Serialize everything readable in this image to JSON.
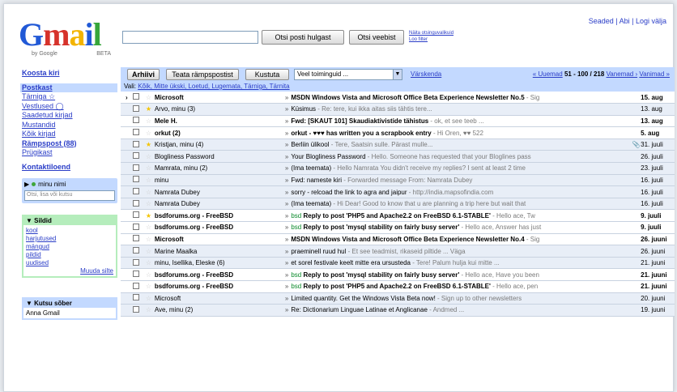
{
  "brand": {
    "logo_g": "G",
    "logo_m": "m",
    "logo_a": "a",
    "logo_i": "i",
    "logo_l": "l",
    "by": "by Google",
    "beta": "BETA"
  },
  "header": {
    "search_button": "Otsi posti hulgast",
    "web_button": "Otsi veebist",
    "search_options": "Näita otsinguvalikuid",
    "create_filter": "Loo filter",
    "top_links": "Seaded | Abi | Logi välja"
  },
  "sidebar": {
    "compose": "Koosta kiri",
    "items": [
      "Postkast",
      "Tärniga ☆",
      "Vestlused ◯",
      "Saadetud kirjad",
      "Mustandid",
      "Kõik kirjad",
      "Rämpspost (88)",
      "Prügikast"
    ],
    "contacts": "Kontaktiloend",
    "chat_status": "minu nimi",
    "chat_search_placeholder": "Otsi, lisa või kutsu",
    "labels_title": "Sildid",
    "labels": [
      "kool",
      "harjutused",
      "mängud",
      "pildid",
      "uudised"
    ],
    "labels_edit": "Muuda silte",
    "invite_title": "Kutsu sõber",
    "invite_text": "Anna Gmail"
  },
  "toolbar": {
    "archive": "Arhiivi",
    "spam": "Teata rämpspostist",
    "delete": "Kustuta",
    "more_actions": "Veel toiminguid ...",
    "refresh": "Värskenda",
    "pager_prev": "« Uuemad",
    "pager_count": "51 - 100 / 218",
    "pager_older": "Vanemad ›",
    "pager_oldest": "Vanimad »",
    "select_prefix": "Vali:",
    "select_links": "Kõik, Mitte ükski, Loetud, Lugemata, Tärniga, Tärnita"
  },
  "emails": [
    {
      "from": "Microsoft",
      "subject": "MSDN Windows Vista and Microsoft Office Beta Experience Newsletter No.5",
      "snippet": " - Sig",
      "date": "15. aug",
      "unread": true,
      "star": false,
      "arrow": true,
      "label": ""
    },
    {
      "from": "Arvo, minu (3)",
      "subject": "Küsimus",
      "snippet": " - Re: tere, kui ikka aitas siis tähtis tere...",
      "date": "13. aug",
      "unread": false,
      "star": true,
      "arrow": false,
      "label": ""
    },
    {
      "from": "Mele H.",
      "subject": "Fwd: [SKAUT 101] Skaudiaktivistide tähistus",
      "snippet": " - ok, et see teeb ...",
      "date": "13. aug",
      "unread": true,
      "star": false,
      "arrow": false,
      "label": ""
    },
    {
      "from": "orkut (2)",
      "subject": "orkut - ♥♥♥ has written you a scrapbook entry",
      "snippet": " - Hi Oren, ♥♥ 522",
      "date": "5. aug",
      "unread": true,
      "star": false,
      "arrow": false,
      "label": ""
    },
    {
      "from": "Kristjan, minu (4)",
      "subject": "Berliin ülikool",
      "snippet": " - Tere, Saatsin sulle. Pärast mulle...",
      "date": "31. juuli",
      "unread": false,
      "star": true,
      "arrow": false,
      "label": "",
      "clip": true
    },
    {
      "from": "Blogliness Password",
      "subject": "Your Blogliness Password",
      "snippet": " - Hello. Someone has requested that your Bloglines pass",
      "date": "26. juuli",
      "unread": false,
      "star": false,
      "arrow": false,
      "label": ""
    },
    {
      "from": "Mamrata, minu (2)",
      "subject": "(Ima teemata)",
      "snippet": " - Hello Namrata You didn't receive my replies? I sent at least 2 time",
      "date": "23. juuli",
      "unread": false,
      "star": false,
      "arrow": false,
      "label": ""
    },
    {
      "from": "minu",
      "subject": "Fwd: nameste kiri",
      "snippet": " - Forwarded message From: Namrata Dubey",
      "date": "16. juuli",
      "unread": false,
      "star": false,
      "arrow": false,
      "label": ""
    },
    {
      "from": "Namrata Dubey",
      "subject": "sorry - relcoad the link to agra and jaipur",
      "snippet": " - http://india.mapsofindia.com",
      "date": "16. juuli",
      "unread": false,
      "star": false,
      "arrow": false,
      "label": ""
    },
    {
      "from": "Namrata Dubey",
      "subject": "(Ima teemata)",
      "snippet": " - Hi Dear! Good to know that u are planning a trip here but wait that",
      "date": "16. juuli",
      "unread": false,
      "star": false,
      "arrow": false,
      "label": ""
    },
    {
      "from": "bsdforums.org - FreeBSD",
      "subject": "Reply to post 'PHP5 and Apache2.2 on FreeBSD 6.1-STABLE'",
      "snippet": " - Hello ace, Tw",
      "date": "9. juuli",
      "unread": true,
      "star": true,
      "arrow": false,
      "label": "bsd"
    },
    {
      "from": "bsdforums.org - FreeBSD",
      "subject": "Reply to post 'mysql stability on fairly busy server'",
      "snippet": " - Hello ace, Answer has just",
      "date": "9. juuli",
      "unread": true,
      "star": false,
      "arrow": false,
      "label": "bsd"
    },
    {
      "from": "Microsoft",
      "subject": "MSDN Windows Vista and Microsoft Office Beta Experience Newsletter No.4",
      "snippet": " - Sig",
      "date": "26. juuni",
      "unread": true,
      "star": false,
      "arrow": false,
      "label": ""
    },
    {
      "from": "Marine Maalka",
      "subject": "praeminell ruud hul",
      "snippet": " - Et see teadmist, rikaseid piltide ... Väga",
      "date": "26. juuni",
      "unread": false,
      "star": false,
      "arrow": false,
      "label": ""
    },
    {
      "from": "minu, Isellika, Eleske (6)",
      "subject": "et sorel festivale keelt mitte era ursusteda",
      "snippet": " - Tere! Palum hulja kui mitte ...",
      "date": "21. juuni",
      "unread": false,
      "star": false,
      "arrow": false,
      "label": ""
    },
    {
      "from": "bsdforums.org - FreeBSD",
      "subject": "Reply to post 'mysql stability on fairly busy server'",
      "snippet": " - Hello ace, Have you been",
      "date": "21. juuni",
      "unread": true,
      "star": false,
      "arrow": false,
      "label": "bsd"
    },
    {
      "from": "bsdforums.org - FreeBSD",
      "subject": "Reply to post 'PHP5 and Apache2.2 on FreeBSD 6.1-STABLE'",
      "snippet": " - Hello ace, pen",
      "date": "21. juuni",
      "unread": true,
      "star": false,
      "arrow": false,
      "label": "bsd"
    },
    {
      "from": "Microsoft",
      "subject": "Limited quantity. Get the Windows Vista Beta now!",
      "snippet": " - Sign up to other newsletters",
      "date": "20. juuni",
      "unread": false,
      "star": false,
      "arrow": false,
      "label": ""
    },
    {
      "from": "Ave, minu (2)",
      "subject": "Re: Dictionarium Linguae Latinae et Anglicanae",
      "snippet": " - Andmed ...",
      "date": "19. juuni",
      "unread": false,
      "star": false,
      "arrow": false,
      "label": ""
    }
  ]
}
